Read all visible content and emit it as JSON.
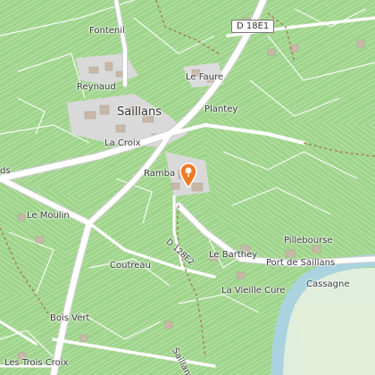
{
  "map": {
    "colors": {
      "vineyard": "#9fd48c",
      "urban": "#d9d9d9",
      "road": "#ffffff",
      "road_casing": "#cfcfcf",
      "river": "#aad3df",
      "marker": "#f07a25"
    },
    "labels": {
      "saillans": "Saillans",
      "fontenil": "Fontenil",
      "reynaud": "Reynaud",
      "le_faure": "Le Faure",
      "plantey": "Plantey",
      "la_croix": "La Croix",
      "rambaud": "Ramba",
      "ds": "ds",
      "le_moulin": "Le Moulin",
      "coutreau": "Coutreau",
      "le_barthey": "Le Barthey",
      "pillebourse": "Pillebourse",
      "port_de_saillans": "Port de Saillans",
      "cassagne": "Cassagne",
      "la_vieille_cure": "La Vieille Cure",
      "bois_vert": "Bois Vert",
      "les_trois_croix": "Les Trois Croix",
      "saillans_bottom": "Saillans"
    },
    "road_labels": {
      "d18e1": "D 18E1",
      "d128e2": "D 128E2"
    },
    "marker_icon": "map-pin-icon"
  }
}
